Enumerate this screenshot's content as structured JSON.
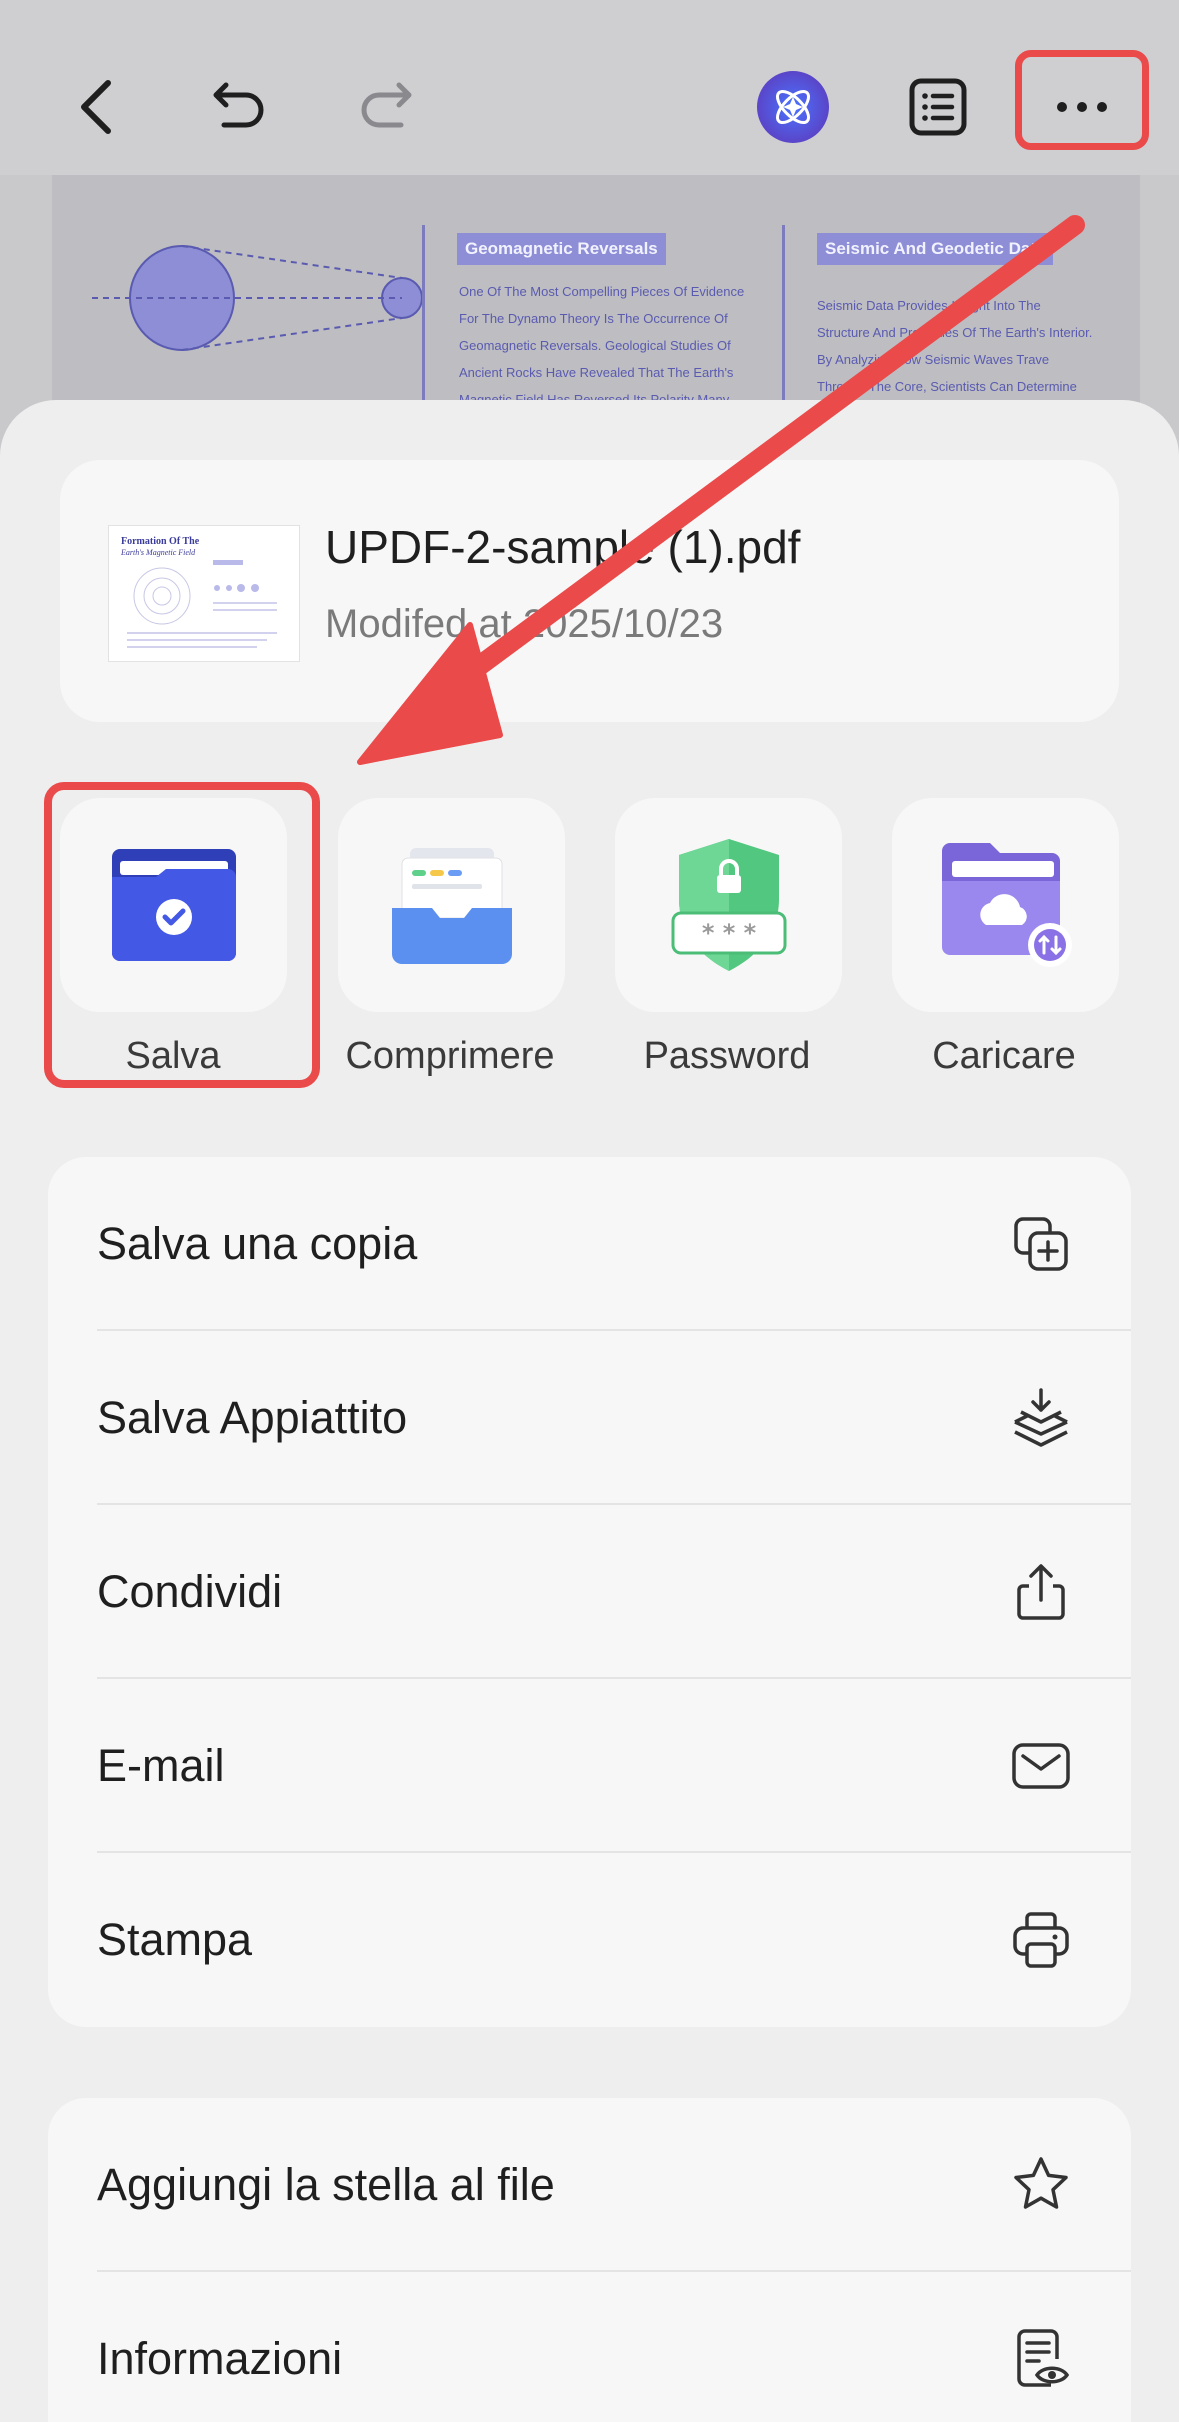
{
  "toolbar": {
    "back_icon": "chevron-left-icon",
    "undo_icon": "undo-icon",
    "redo_icon": "redo-icon",
    "ai_icon": "ai-assistant-icon",
    "outline_icon": "list-icon",
    "more_icon": "more-icon"
  },
  "document_preview": {
    "heading_1": "Geomagnetic Reversals",
    "text_1": [
      "One Of The Most Compelling Pieces Of Evidence",
      "For The Dynamo Theory Is The Occurrence Of",
      "Geomagnetic Reversals. Geological Studies Of",
      "Ancient Rocks Have Revealed That The Earth's",
      "Magnetic Field Has Reversed Its Polarity Many"
    ],
    "heading_2": "Seismic And Geodetic Data",
    "text_2": [
      "Seismic Data Provides Insight Into The",
      "Structure And Properties Of The Earth's Interior.",
      "By Analyzing How Seismic Waves Trave",
      "Through The Core, Scientists Can Determine"
    ]
  },
  "file": {
    "name": "UPDF-2-sample (1).pdf",
    "modified": "Modifed at 2025/10/23",
    "thumb_title": "Formation Of The",
    "thumb_subtitle": "Earth's Magnetic Field"
  },
  "actions": [
    {
      "label": "Salva",
      "icon": "save-folder-icon",
      "color": "#3d55e0"
    },
    {
      "label": "Comprimere",
      "icon": "compress-tray-icon",
      "color": "#5b8ff0"
    },
    {
      "label": "Password",
      "icon": "password-shield-icon",
      "color": "#4cc57a"
    },
    {
      "label": "Caricare",
      "icon": "cloud-upload-folder-icon",
      "color": "#8a72e6"
    }
  ],
  "menu_main": [
    {
      "label": "Salva una copia",
      "icon": "copy-plus-icon"
    },
    {
      "label": "Salva Appiattito",
      "icon": "flatten-download-icon"
    },
    {
      "label": "Condividi",
      "icon": "share-icon"
    },
    {
      "label": "E-mail",
      "icon": "mail-icon"
    },
    {
      "label": "Stampa",
      "icon": "print-icon"
    }
  ],
  "menu_secondary": [
    {
      "label": "Aggiungi la stella al file",
      "icon": "star-icon"
    },
    {
      "label": "Informazioni",
      "icon": "file-info-icon"
    }
  ],
  "highlight_color": "#ea4a4a"
}
